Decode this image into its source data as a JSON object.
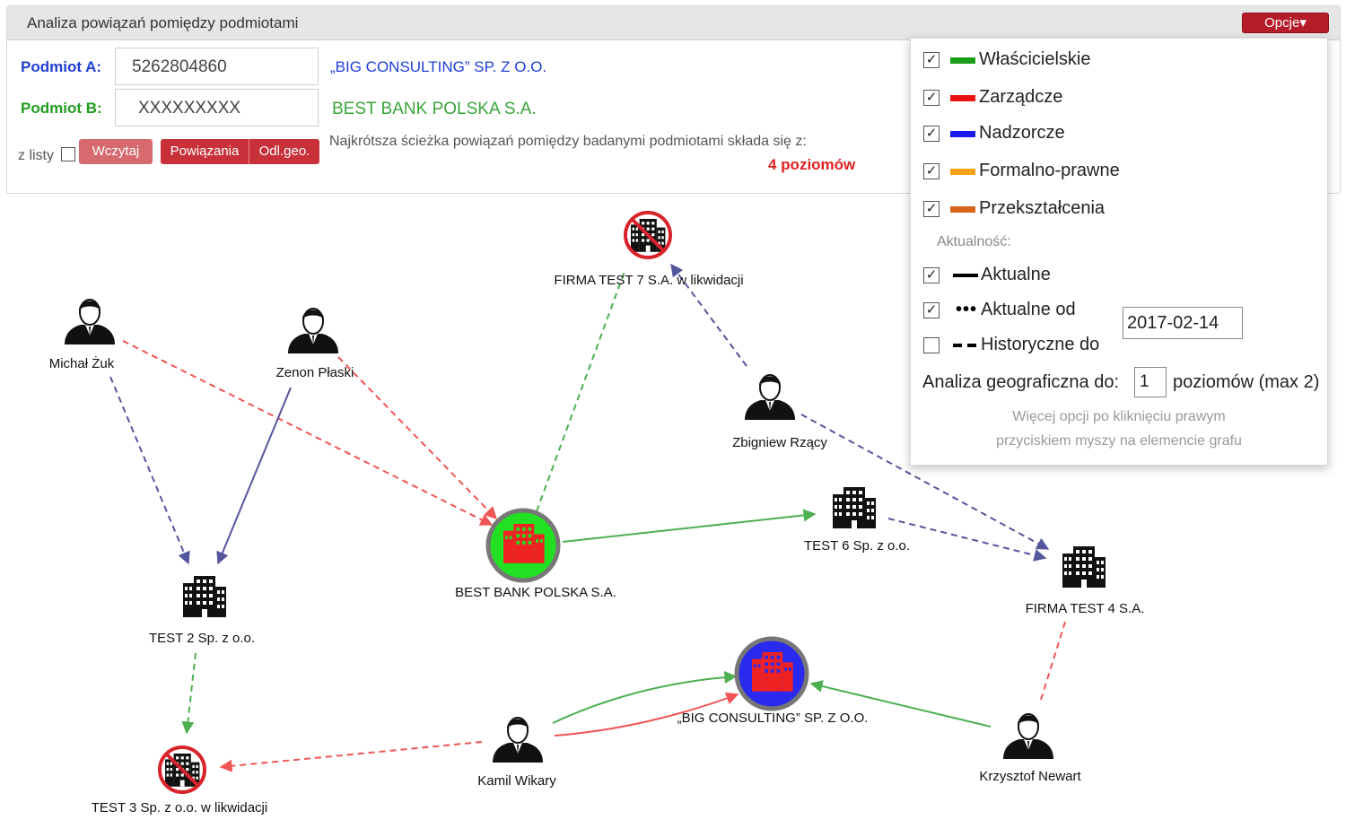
{
  "panel": {
    "title": "Analiza powiązań pomiędzy podmiotami",
    "options_button": "Opcje▾",
    "subject_a_label": "Podmiot A:",
    "subject_a_value": "5262804860",
    "subject_a_name": "„BIG CONSULTING” SP. Z O.O.",
    "subject_b_label": "Podmiot B:",
    "subject_b_value": "XXXXXXXXX",
    "subject_b_name": "BEST BANK POLSKA S.A.",
    "from_list_label": "z listy",
    "load_button": "Wczytaj",
    "relations_button": "Powiązania",
    "geo_button": "Odl.geo.",
    "path_text": "Najkrótsza ścieżka powiązań pomiędzy badanymi podmiotami składa się z:",
    "path_levels": "4 poziomów"
  },
  "options": {
    "relation_types": [
      {
        "label": "Właścicielskie",
        "checked": true,
        "color": "#1a9e1a"
      },
      {
        "label": "Zarządcze",
        "checked": true,
        "color": "#ee1111"
      },
      {
        "label": "Nadzorcze",
        "checked": true,
        "color": "#1a1aee"
      },
      {
        "label": "Formalno-prawne",
        "checked": true,
        "color": "#f5a21a"
      },
      {
        "label": "Przekształcenia",
        "checked": true,
        "color": "#d8661a"
      }
    ],
    "actuality_label": "Aktualność:",
    "actuality": [
      {
        "label": "Aktualne",
        "checked": true
      },
      {
        "label": "Aktualne od",
        "checked": true
      },
      {
        "label": "Historyczne do",
        "checked": false
      }
    ],
    "date_value": "2017-02-14",
    "geo_label": "Analiza geograficzna do:",
    "geo_value": "1",
    "geo_suffix": "poziomów (max 2)",
    "hint_line1": "Więcej opcji po kliknięciu prawym",
    "hint_line2": "przyciskiem myszy na elemencie grafu"
  },
  "graph": {
    "nodes": [
      {
        "id": "firma7",
        "label": "FIRMA TEST 7 S.A. w likwidacji",
        "kind": "company-liquidated"
      },
      {
        "id": "zuk",
        "label": "Michał Żuk",
        "kind": "person"
      },
      {
        "id": "plaski",
        "label": "Zenon Płaski",
        "kind": "person"
      },
      {
        "id": "rzacy",
        "label": "Zbigniew Rzący",
        "kind": "person"
      },
      {
        "id": "bestbank",
        "label": "BEST BANK POLSKA S.A.",
        "kind": "company-subject-b"
      },
      {
        "id": "test6",
        "label": "TEST 6 Sp. z o.o.",
        "kind": "company"
      },
      {
        "id": "firma4",
        "label": "FIRMA TEST 4 S.A.",
        "kind": "company"
      },
      {
        "id": "test2",
        "label": "TEST 2 Sp. z o.o.",
        "kind": "company"
      },
      {
        "id": "bigcons",
        "label": "„BIG CONSULTING” SP. Z O.O.",
        "kind": "company-subject-a"
      },
      {
        "id": "test3",
        "label": "TEST 3 Sp. z o.o. w likwidacji",
        "kind": "company-liquidated"
      },
      {
        "id": "wikary",
        "label": "Kamil Wikary",
        "kind": "person"
      },
      {
        "id": "newart",
        "label": "Krzysztof Newart",
        "kind": "person"
      }
    ]
  }
}
